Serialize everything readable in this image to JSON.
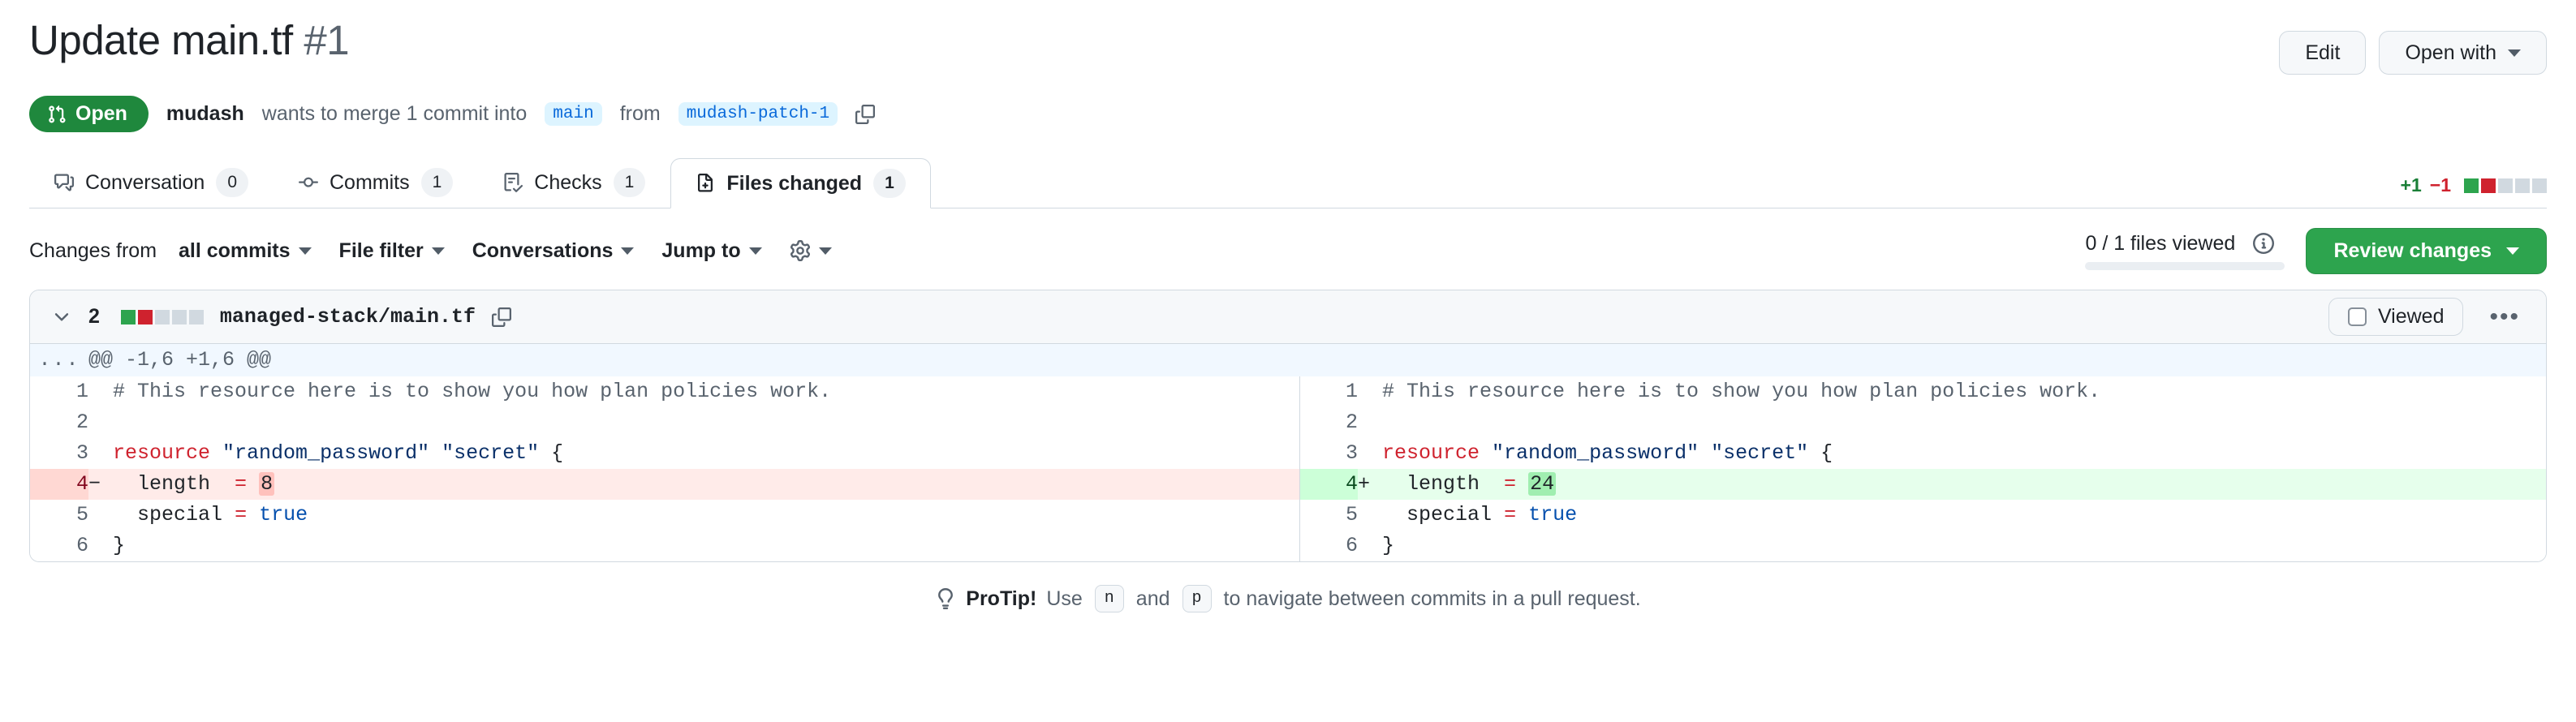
{
  "header": {
    "title": "Update main.tf",
    "number": "#1",
    "edit_label": "Edit",
    "open_with_label": "Open with",
    "state": "Open",
    "author": "mudash",
    "merge_text_1": "wants to merge 1 commit into",
    "base_ref": "main",
    "merge_text_2": "from",
    "head_ref": "mudash-patch-1"
  },
  "tabs": [
    {
      "label": "Conversation",
      "count": "0",
      "icon": "comment-icon",
      "active": false
    },
    {
      "label": "Commits",
      "count": "1",
      "icon": "commit-icon",
      "active": false
    },
    {
      "label": "Checks",
      "count": "1",
      "icon": "checklist-icon",
      "active": false
    },
    {
      "label": "Files changed",
      "count": "1",
      "icon": "diff-file-icon",
      "active": true
    }
  ],
  "diffstat_top": {
    "additions": "+1",
    "deletions": "−1",
    "blocks": [
      "g",
      "r",
      "n",
      "n",
      "n"
    ]
  },
  "toolbar": {
    "changes_from_lead": "Changes from",
    "changes_from_value": "all commits",
    "file_filter_label": "File filter",
    "conversations_label": "Conversations",
    "jump_to_label": "Jump to",
    "gear_icon": "gear-icon",
    "viewed_text": "0 / 1 files viewed",
    "info_icon": "info-icon",
    "progress_percent": 0,
    "review_changes_label": "Review changes"
  },
  "file": {
    "change_count": "2",
    "blocks": [
      "g",
      "r",
      "n",
      "n",
      "n"
    ],
    "path": "managed-stack/main.tf",
    "copy_icon": "copy-icon",
    "viewed_label": "Viewed",
    "viewed_checked": false,
    "kebab_icon": "kebab-horizontal-icon",
    "hunk_header": "@@ -1,6 +1,6 @@",
    "expand_label": "...",
    "rows": [
      {
        "left_num": "1",
        "left_marker": "",
        "left_kind": "ctx",
        "right_num": "1",
        "right_marker": "",
        "right_kind": "ctx",
        "left_code": "# This resource here is to show you how plan policies work.",
        "right_code": "# This resource here is to show you how plan policies work."
      },
      {
        "left_num": "2",
        "left_marker": "",
        "left_kind": "ctx",
        "right_num": "2",
        "right_marker": "",
        "right_kind": "ctx",
        "left_code": "",
        "right_code": ""
      },
      {
        "left_num": "3",
        "left_marker": "",
        "left_kind": "ctx",
        "right_num": "3",
        "right_marker": "",
        "right_kind": "ctx",
        "left_code": "resource \"random_password\" \"secret\" {",
        "right_code": "resource \"random_password\" \"secret\" {"
      },
      {
        "left_num": "4",
        "left_marker": "−",
        "left_kind": "del",
        "right_num": "4",
        "right_marker": "+",
        "right_kind": "add",
        "left_code": "  length  = 8",
        "right_code": "  length  = 24",
        "left_highlight": "8",
        "right_highlight": "24"
      },
      {
        "left_num": "5",
        "left_marker": "",
        "left_kind": "ctx",
        "right_num": "5",
        "right_marker": "",
        "right_kind": "ctx",
        "left_code": "  special = true",
        "right_code": "  special = true"
      },
      {
        "left_num": "6",
        "left_marker": "",
        "left_kind": "ctx",
        "right_num": "6",
        "right_marker": "",
        "right_kind": "ctx",
        "left_code": "}",
        "right_code": "}"
      }
    ]
  },
  "protip": {
    "icon": "lightbulb-icon",
    "label": "ProTip!",
    "text_1": "Use",
    "key_1": "n",
    "text_2": "and",
    "key_2": "p",
    "text_3": "to navigate between commits in a pull request."
  }
}
